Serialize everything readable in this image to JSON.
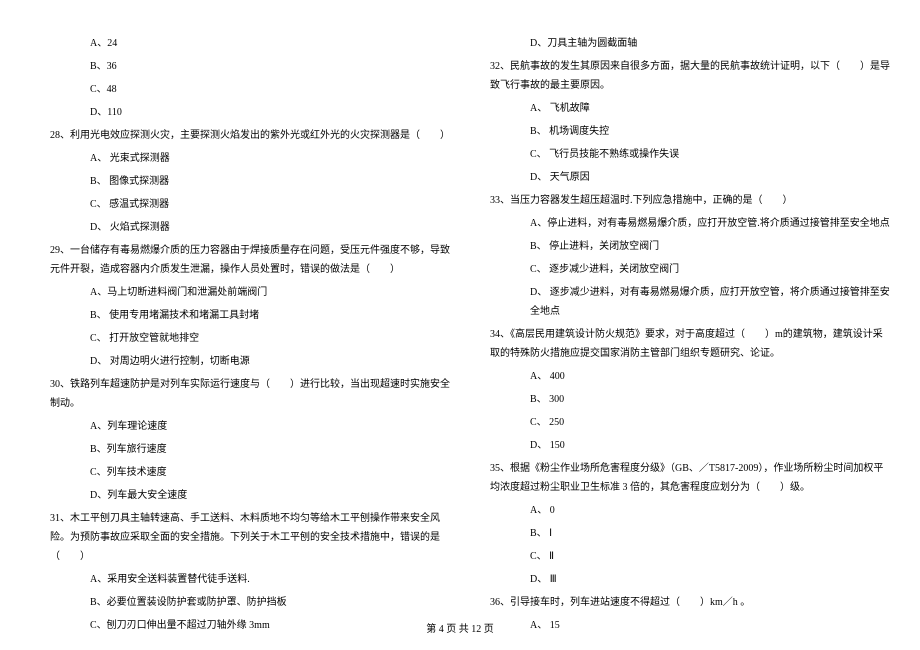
{
  "left": {
    "q27_opts": [
      "A、24",
      "B、36",
      "C、48",
      "D、110"
    ],
    "q28": "28、利用光电效应探测火灾，主要探测火焰发出的紫外光或红外光的火灾探测器是（　　）",
    "q28_opts": [
      "A、 光束式探测器",
      "B、 图像式探测器",
      "C、 感温式探测器",
      "D、 火焰式探测器"
    ],
    "q29": "29、一台储存有毒易燃爆介质的压力容器由于焊接质量存在问题，受压元件强度不够，导致元件开裂，造成容器内介质发生泄漏，操作人员处置时，错误的做法是（　　）",
    "q29_opts": [
      "A、马上切断进料阀门和泄漏处前端阀门",
      "B、 使用专用堵漏技术和堵漏工具封堵",
      "C、 打开放空管就地排空",
      "D、 对周边明火进行控制，切断电源"
    ],
    "q30": "30、铁路列车超速防护是对列车实际运行速度与（　　）进行比较，当出现超速时实施安全制动。",
    "q30_opts": [
      "A、列车理论速度",
      "B、列车旅行速度",
      "C、列车技术速度",
      "D、列车最大安全速度"
    ],
    "q31": "31、木工平刨刀具主轴转速高、手工送料、木料质地不均匀等给木工平刨操作带来安全风险。为预防事故应采取全面的安全措施。下列关于木工平刨的安全技术措施中，错误的是（　　）",
    "q31_opts": [
      "A、采用安全送料装置替代徒手送料.",
      "B、必要位置装设防护套或防护罩、防护挡板",
      "C、刨刀刃口伸出量不超过刀轴外缘 3mm"
    ]
  },
  "right": {
    "q31d": "D、刀具主轴为圆截面轴",
    "q32": "32、民航事故的发生其原因来自很多方面，据大量的民航事故统计证明，以下（　　）是导致飞行事故的最主要原因。",
    "q32_opts": [
      "A、 飞机故障",
      "B、 机场调度失控",
      "C、 飞行员技能不熟练或操作失误",
      "D、 天气原因"
    ],
    "q33": "33、当压力容器发生超压超温时.下列应急措施中，正确的是（　　）",
    "q33_opts": [
      "A、停止进料，对有毒易燃易爆介质，应打开放空管.将介质通过接管排至安全地点",
      "B、 停止进料，关闭放空阀门",
      "C、 逐步减少进料，关闭放空阀门",
      "D、 逐步减少进料，对有毒易燃易爆介质，应打开放空管，将介质通过接管排至安全地点"
    ],
    "q34": "34、《高层民用建筑设计防火规范》要求，对于高度超过（　　）m的建筑物，建筑设计采取的特殊防火措施应提交国家消防主管部门组织专题研究、论证。",
    "q34_opts": [
      "A、 400",
      "B、 300",
      "C、 250",
      "D、 150"
    ],
    "q35": "35、根据《粉尘作业场所危害程度分级》（GB、／T5817-2009），作业场所粉尘时间加权平均浓度超过粉尘职业卫生标准 3 倍的，其危害程度应划分为（　　）级。",
    "q35_opts": [
      "A、 0",
      "B、 Ⅰ",
      "C、 Ⅱ",
      "D、 Ⅲ"
    ],
    "q36": "36、引导接车时，列车进站速度不得超过（　　）km／h 。",
    "q36_opts": [
      "A、 15"
    ]
  },
  "footer": "第 4 页 共 12 页"
}
